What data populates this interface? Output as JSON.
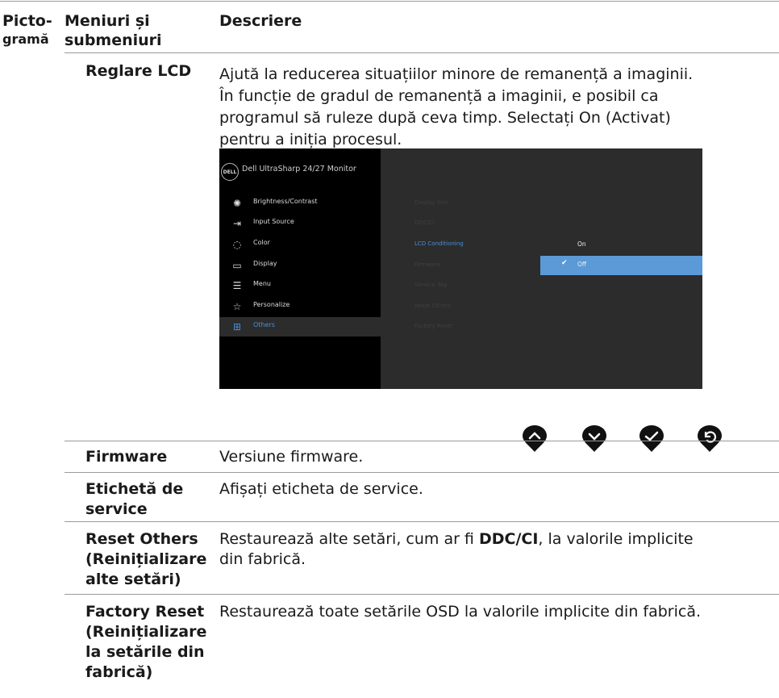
{
  "header": {
    "col_icon": [
      "Picto-",
      "gramă"
    ],
    "col_menu": [
      "Meniuri și",
      "submeniuri"
    ],
    "col_desc": "Descriere"
  },
  "rows": [
    {
      "label": [
        "Reglare LCD"
      ],
      "desc": [
        "Ajută la reducerea situațiilor minore de remanență a imaginii.",
        "În funcție de gradul de remanență a imaginii, e posibil ca",
        "programul să ruleze după ceva timp. Selectați On (Activat)",
        "pentru a iniția procesul."
      ]
    },
    {
      "label": [
        "Firmware"
      ],
      "desc": [
        "Versiune firmware."
      ]
    },
    {
      "label": [
        "Etichetă de",
        "service"
      ],
      "desc": [
        "Afișați eticheta de service."
      ]
    },
    {
      "label": [
        "Reset Others",
        "(Reinițializare",
        "alte setări)"
      ],
      "desc_parts": [
        "Restaurează alte setări, cum ar fi ",
        "DDC/CI",
        ", la valorile implicite"
      ],
      "desc_line2": "din fabrică."
    },
    {
      "label": [
        "Factory Reset",
        "(Reinițializare",
        "la setările din",
        "fabrică)"
      ],
      "desc": [
        "Restaurează toate setările OSD la valorile implicite din fabrică."
      ]
    }
  ],
  "osd": {
    "logo": "DELL",
    "title": "Dell UltraSharp 24/27 Monitor",
    "menu": [
      {
        "label": "Brightness/Contrast",
        "icon": "brightness-icon"
      },
      {
        "label": "Input Source",
        "icon": "input-source-icon"
      },
      {
        "label": "Color",
        "icon": "color-palette-icon"
      },
      {
        "label": "Display",
        "icon": "display-icon"
      },
      {
        "label": "Menu",
        "icon": "menu-icon"
      },
      {
        "label": "Personalize",
        "icon": "star-icon"
      },
      {
        "label": "Others",
        "icon": "others-icon",
        "selected": true
      }
    ],
    "submenu": [
      {
        "label": "Display Info"
      },
      {
        "label": "DDC/CI"
      },
      {
        "label": "LCD Conditioning",
        "active": true
      },
      {
        "label": "Firmware"
      },
      {
        "label": "Service Tag"
      },
      {
        "label": "Reset Others"
      },
      {
        "label": "Factory Reset"
      }
    ],
    "options": [
      {
        "label": "On",
        "selected": false
      },
      {
        "label": "Off",
        "selected": true
      }
    ],
    "accent_color": "#5b9ad6"
  },
  "nav_buttons": [
    "up-button-icon",
    "down-button-icon",
    "confirm-button-icon",
    "back-button-icon"
  ]
}
